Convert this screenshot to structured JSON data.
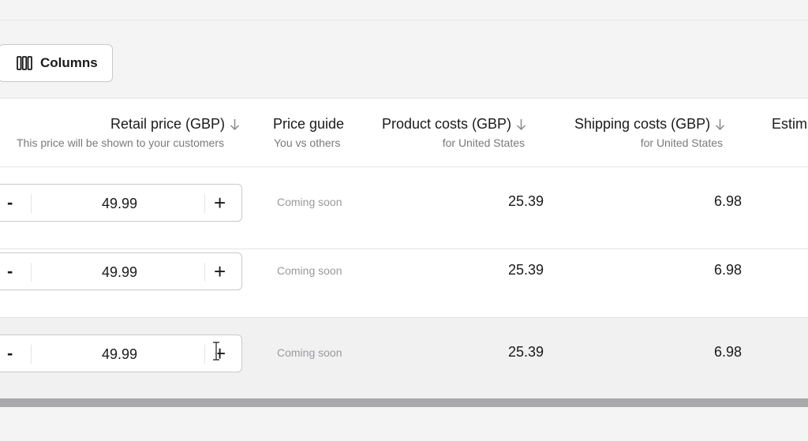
{
  "toolbar": {
    "columns_label": "Columns",
    "columns_icon": "columns-icon"
  },
  "table": {
    "headers": {
      "retail_price": {
        "title": "Retail price (GBP)",
        "subtitle": "This price will be shown to your customers",
        "sort_icon": "arrow-down-icon"
      },
      "price_guide": {
        "title": "Price guide",
        "subtitle": "You vs others"
      },
      "product_costs": {
        "title": "Product costs (GBP)",
        "subtitle": "for United States",
        "sort_icon": "arrow-down-icon"
      },
      "shipping_costs": {
        "title": "Shipping costs (GBP)",
        "subtitle": "for United States",
        "sort_icon": "arrow-down-icon"
      },
      "estimated": {
        "title": "Estim"
      }
    },
    "rows": [
      {
        "minus": "-",
        "plus": "+",
        "retail_price": "49.99",
        "price_guide": "Coming soon",
        "product_costs": "25.39",
        "shipping_costs": "6.98"
      },
      {
        "minus": "-",
        "plus": "+",
        "retail_price": "49.99",
        "price_guide": "Coming soon",
        "product_costs": "25.39",
        "shipping_costs": "6.98"
      },
      {
        "minus": "-",
        "plus": "+",
        "retail_price": "49.99",
        "price_guide": "Coming soon",
        "product_costs": "25.39",
        "shipping_costs": "6.98"
      }
    ]
  },
  "colors": {
    "background": "#f4f4f5",
    "table_bg": "#ffffff",
    "hover_row": "#f1f1f2",
    "border": "#c9c9cc",
    "muted_text": "#7a7a7e",
    "scrollbar": "#a9a9ab"
  }
}
